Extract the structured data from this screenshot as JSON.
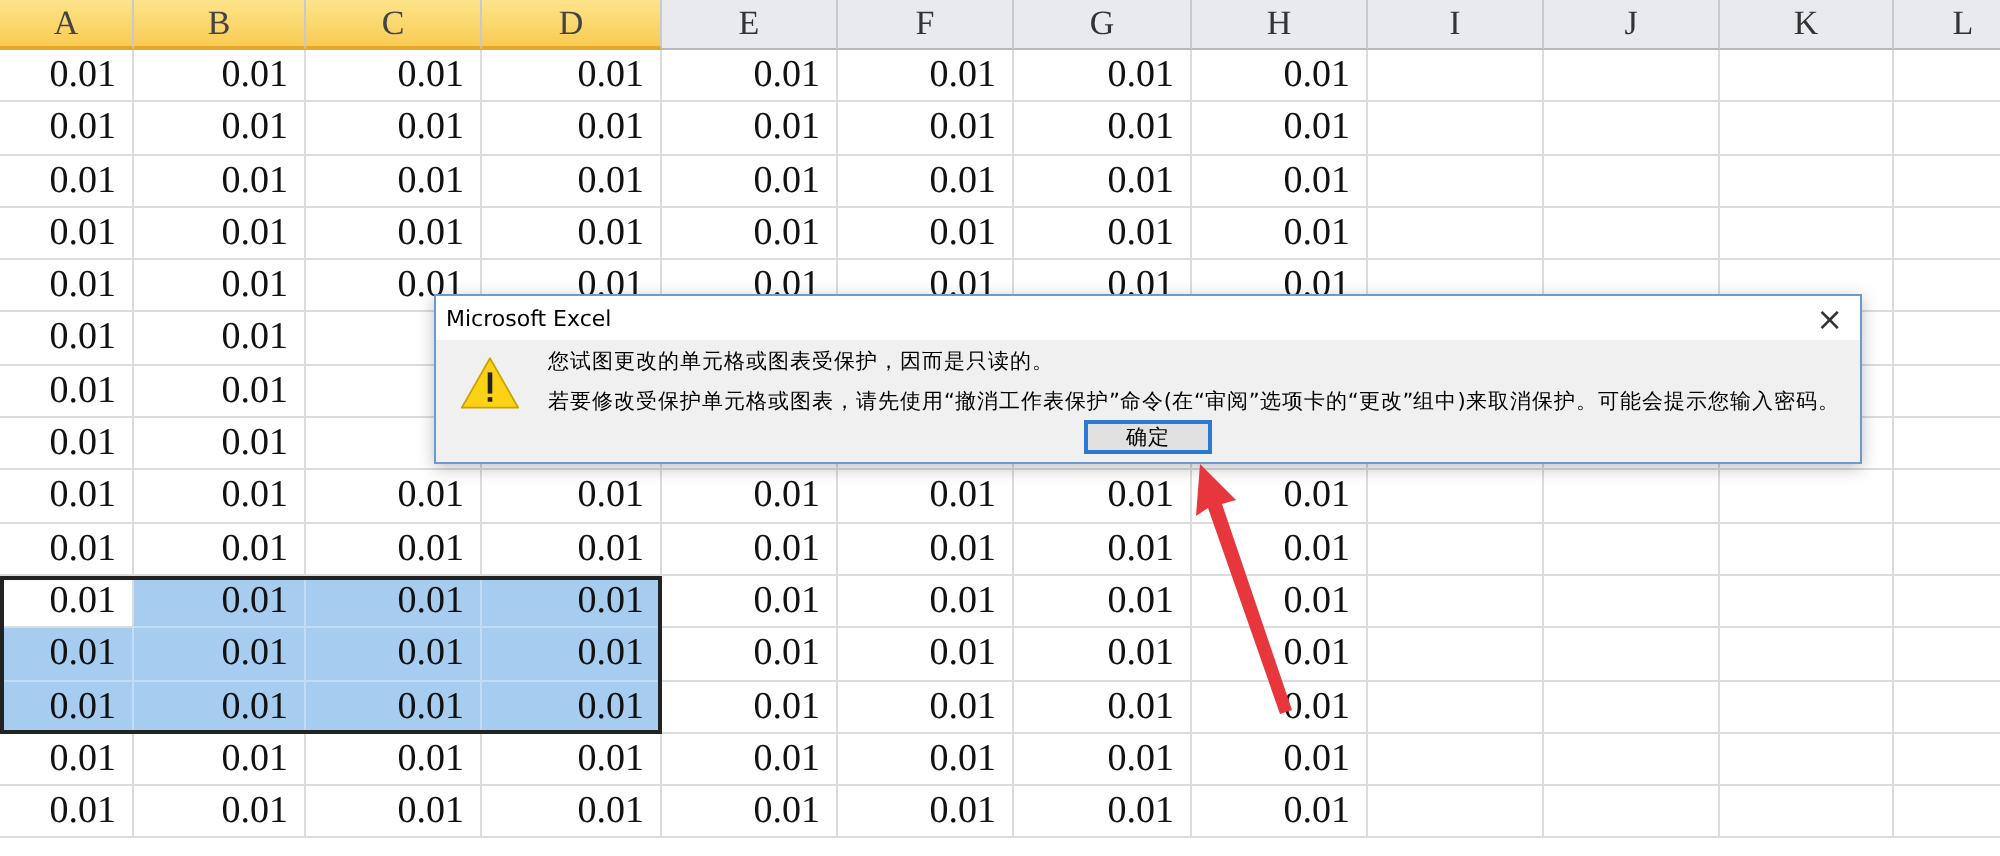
{
  "columns": [
    {
      "label": "A",
      "selected": true
    },
    {
      "label": "B",
      "selected": true
    },
    {
      "label": "C",
      "selected": true
    },
    {
      "label": "D",
      "selected": true
    },
    {
      "label": "E",
      "selected": false
    },
    {
      "label": "F",
      "selected": false
    },
    {
      "label": "G",
      "selected": false
    },
    {
      "label": "H",
      "selected": false
    },
    {
      "label": "I",
      "selected": false
    },
    {
      "label": "J",
      "selected": false
    },
    {
      "label": "K",
      "selected": false
    },
    {
      "label": "L",
      "selected": false
    }
  ],
  "rows": [
    {
      "selected": false,
      "values": [
        "0.01",
        "0.01",
        "0.01",
        "0.01",
        "0.01",
        "0.01",
        "0.01",
        "0.01"
      ]
    },
    {
      "selected": false,
      "values": [
        "0.01",
        "0.01",
        "0.01",
        "0.01",
        "0.01",
        "0.01",
        "0.01",
        "0.01"
      ]
    },
    {
      "selected": false,
      "values": [
        "0.01",
        "0.01",
        "0.01",
        "0.01",
        "0.01",
        "0.01",
        "0.01",
        "0.01"
      ]
    },
    {
      "selected": false,
      "values": [
        "0.01",
        "0.01",
        "0.01",
        "0.01",
        "0.01",
        "0.01",
        "0.01",
        "0.01"
      ]
    },
    {
      "selected": false,
      "values": [
        "0.01",
        "0.01",
        "0.01",
        "0.01",
        "0.01",
        "0.01",
        "0.01",
        "0.01"
      ]
    },
    {
      "selected": false,
      "values": [
        "0.01",
        "0.01"
      ]
    },
    {
      "selected": false,
      "values": [
        "0.01",
        "0.01"
      ]
    },
    {
      "selected": false,
      "values": [
        "0.01",
        "0.01"
      ]
    },
    {
      "selected": false,
      "values": [
        "0.01",
        "0.01",
        "0.01",
        "0.01",
        "0.01",
        "0.01",
        "0.01",
        "0.01"
      ]
    },
    {
      "selected": false,
      "values": [
        "0.01",
        "0.01",
        "0.01",
        "0.01",
        "0.01",
        "0.01",
        "0.01",
        "0.01"
      ]
    },
    {
      "selected": true,
      "values": [
        "0.01",
        "0.01",
        "0.01",
        "0.01",
        "0.01",
        "0.01",
        "0.01",
        "0.01"
      ]
    },
    {
      "selected": true,
      "values": [
        "0.01",
        "0.01",
        "0.01",
        "0.01",
        "0.01",
        "0.01",
        "0.01",
        "0.01"
      ]
    },
    {
      "selected": true,
      "values": [
        "0.01",
        "0.01",
        "0.01",
        "0.01",
        "0.01",
        "0.01",
        "0.01",
        "0.01"
      ]
    },
    {
      "selected": false,
      "values": [
        "0.01",
        "0.01",
        "0.01",
        "0.01",
        "0.01",
        "0.01",
        "0.01",
        "0.01"
      ]
    },
    {
      "selected": false,
      "values": [
        "0.01",
        "0.01",
        "0.01",
        "0.01",
        "0.01",
        "0.01",
        "0.01",
        "0.01"
      ]
    }
  ],
  "dialog": {
    "title": "Microsoft Excel",
    "close": "×",
    "messages": [
      "您试图更改的单元格或图表受保护，因而是只读的。",
      "若要修改受保护单元格或图表，请先使用“撤消工作表保护”命令(在“审阅”选项卡的“更改”组中)来取消保护。可能会提示您输入密码。"
    ],
    "button": "确定"
  }
}
